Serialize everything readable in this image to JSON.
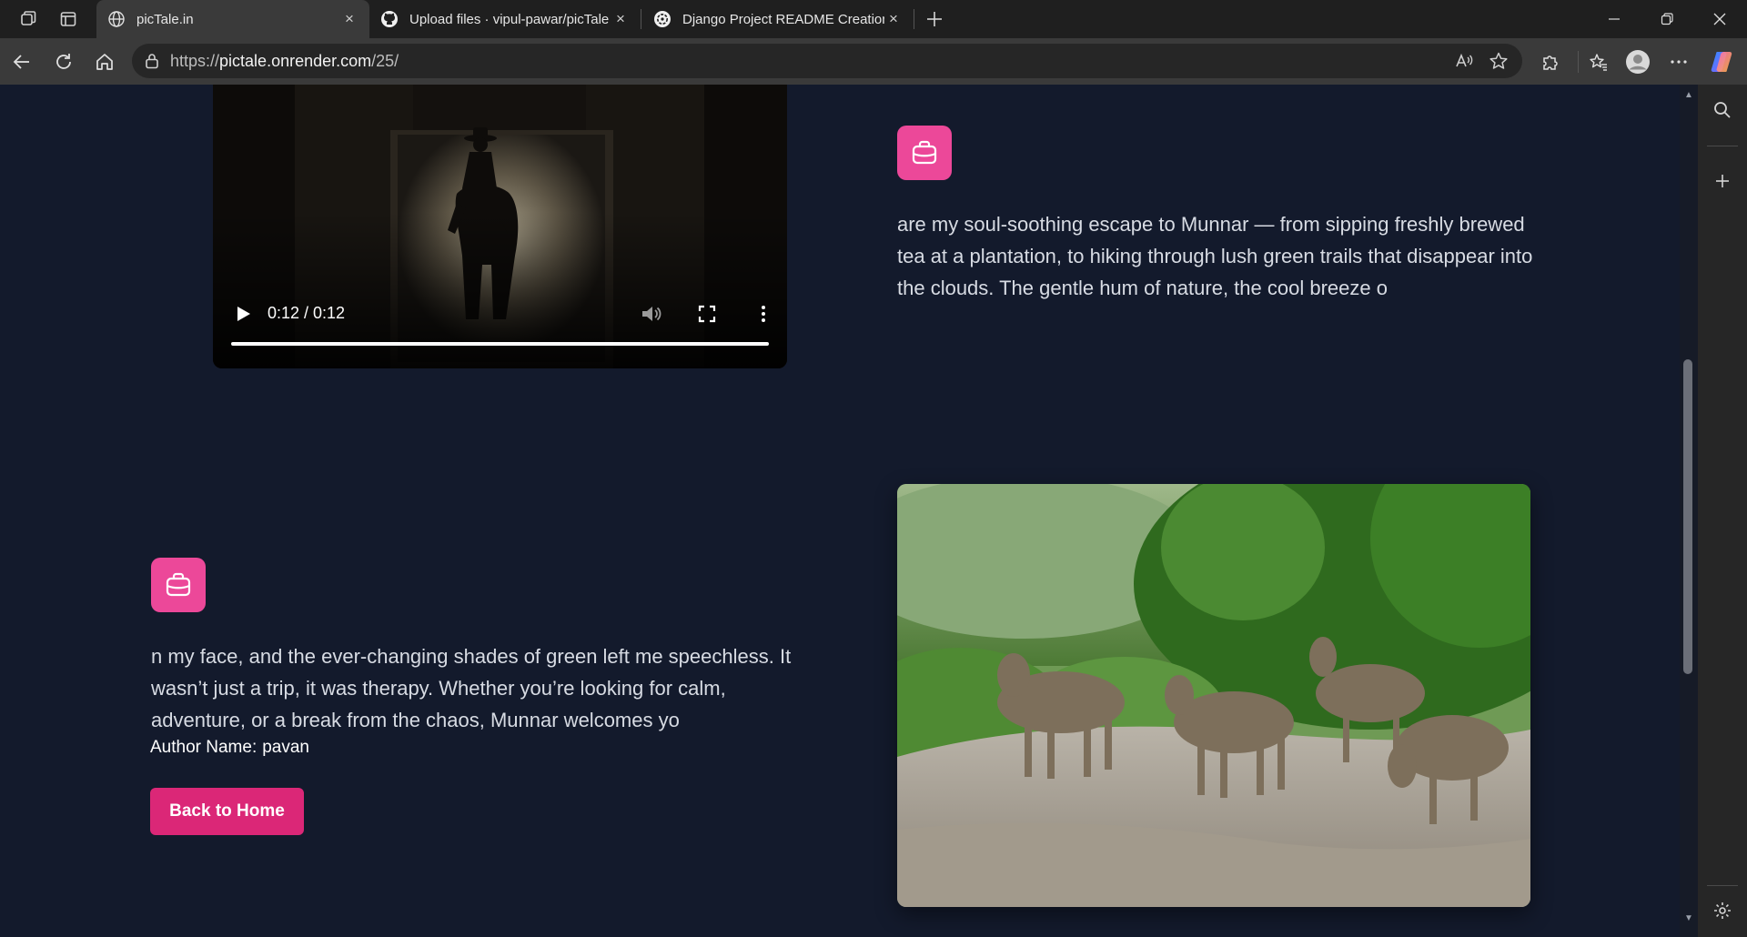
{
  "browser": {
    "tabs": [
      {
        "title": "picTale.in",
        "favicon": "globe-icon",
        "active": true
      },
      {
        "title": "Upload files · vipul-pawar/picTale",
        "favicon": "github-icon",
        "active": false
      },
      {
        "title": "Django Project README Creation",
        "favicon": "openai-icon",
        "active": false
      }
    ],
    "close_glyph": "×",
    "url_prefix": "https://",
    "url_host": "pictale.onrender.com",
    "url_path": "/25/"
  },
  "video": {
    "time": "0:12 / 0:12",
    "progress": 1.0
  },
  "story": {
    "paragraph_1": "are my soul-soothing escape to Munnar — from sipping freshly brewed tea at a plantation, to hiking through lush green trails that disappear into the clouds. The gentle hum of nature, the cool breeze o",
    "paragraph_2": "n my face, and the ever-changing shades of green left me speechless. It wasn’t just a trip, it was therapy. Whether you’re looking for calm, adventure, or a break from the chaos, Munnar welcomes yo",
    "author_label": "Author Name:",
    "author_name": "pavan",
    "back_button": "Back to Home",
    "badge_icon": "briefcase-icon"
  },
  "colors": {
    "page_bg": "#131a2c",
    "accent": "#ec4899",
    "button": "#db2777"
  }
}
